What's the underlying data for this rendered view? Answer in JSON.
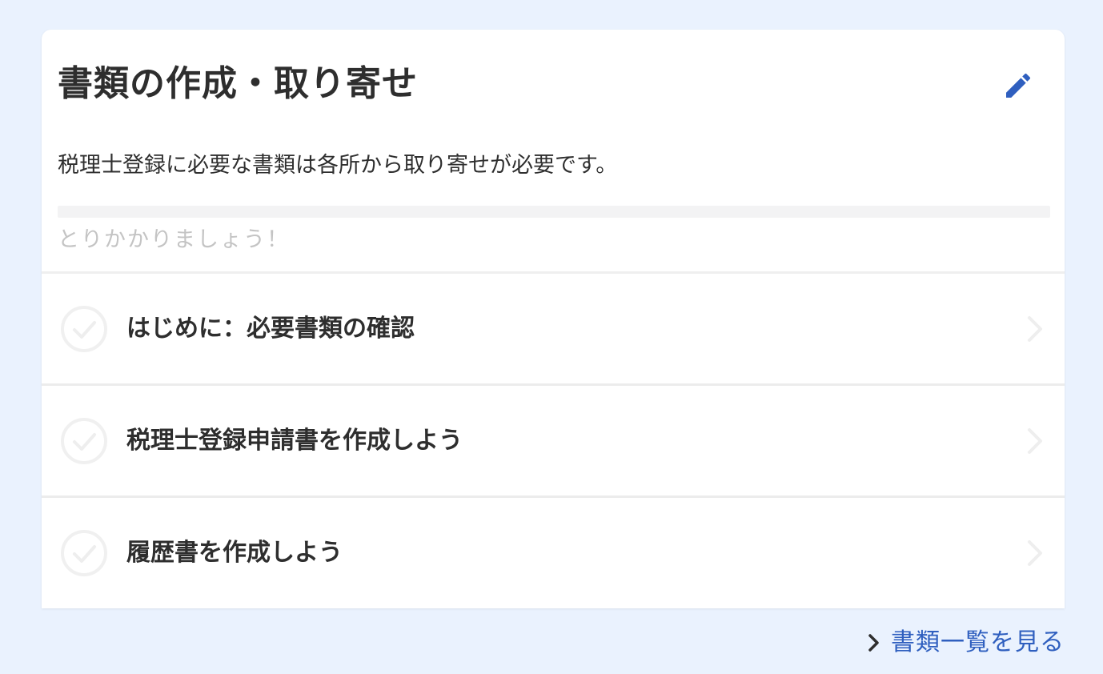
{
  "card": {
    "title": "書類の作成・取り寄せ",
    "edit_icon": "pencil-icon",
    "description": "税理士登録に必要な書類は各所から取り寄せが必要です。",
    "progress": {
      "fraction": 0,
      "text": "とりかかりましょう！"
    },
    "tasks": [
      {
        "label": "はじめに：必要書類の確認",
        "completed": false,
        "icon": "check-circle-icon"
      },
      {
        "label": "税理士登録申請書を作成しよう",
        "completed": false,
        "icon": "check-circle-icon"
      },
      {
        "label": "履歴書を作成しよう",
        "completed": false,
        "icon": "check-circle-icon"
      }
    ]
  },
  "footer": {
    "link_label": "書類一覧を見る",
    "link_icon": "chevron-right-icon"
  },
  "colors": {
    "page_background": "#eaf2fe",
    "accent": "#2f5fbf",
    "text": "#2e2e2e",
    "muted": "#c4c4c4"
  }
}
